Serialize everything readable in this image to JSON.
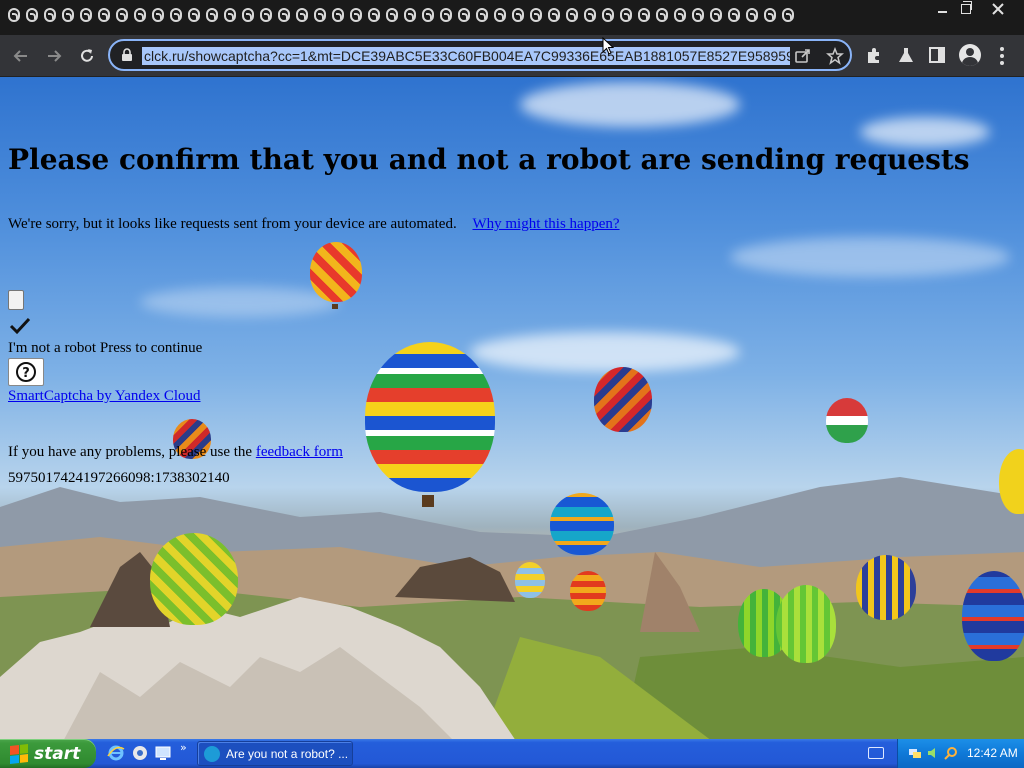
{
  "window": {
    "tab_strip_glyph_count": 44
  },
  "toolbar": {
    "url": "clck.ru/showcaptcha?cc=1&mt=DCE39ABC5E33C60FB004EA7C99336E65EAB1881057E8527E958959",
    "icons": [
      "back-icon",
      "forward-icon",
      "reload-icon",
      "lock-icon",
      "share-icon",
      "bookmark-star-icon",
      "extensions-icon",
      "labs-flask-icon",
      "side-panel-icon",
      "profile-icon",
      "menu-icon"
    ]
  },
  "page": {
    "heading": "Please confirm that you and not a robot are sending requests",
    "sorry_text": "We're sorry, but it looks like requests sent from your device are automated.",
    "why_link": "Why might this happen?",
    "checkbox_label": "I'm not a robot Press to continue",
    "help_button_symbol": "?",
    "smartcaptcha_link": "SmartCaptcha by Yandex Cloud",
    "problems_text": "If you have any problems, please use the",
    "feedback_link": "feedback form",
    "request_id": "5975017424197266098:1738302140"
  },
  "taskbar": {
    "start_label": "start",
    "overflow_chevron": "»",
    "task_item_label": "Are you not a robot? ...",
    "clock": "12:42 AM",
    "colors": {
      "taskbar_blue": "#245edb",
      "start_green": "#3c9a3c",
      "tray_blue": "#0f79d8"
    }
  }
}
